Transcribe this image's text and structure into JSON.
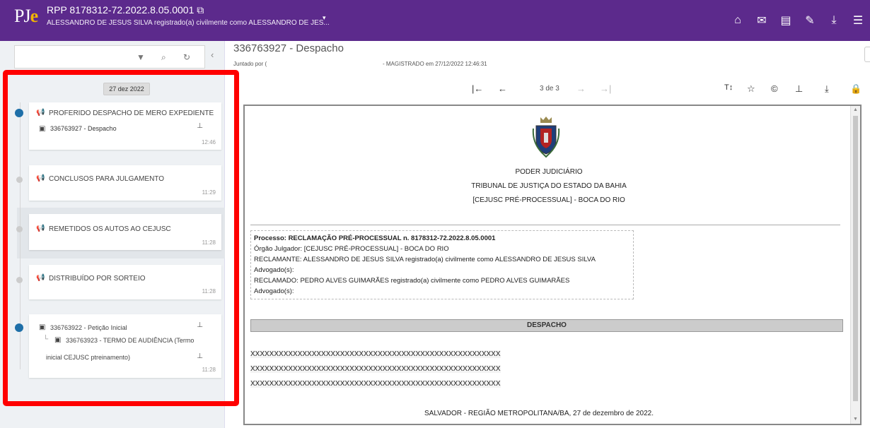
{
  "header": {
    "logo_p": "PJ",
    "logo_e": "e",
    "process_title": "RPP 8178312-72.2022.8.05.0001",
    "subtitle": "ALESSANDRO DE JESUS SILVA registrado(a) civilmente como ALESSANDRO DE JES...",
    "icons": [
      "home-icon",
      "mail-icon",
      "document-icon",
      "edit-icon",
      "download-icon",
      "menu-icon"
    ]
  },
  "timeline": {
    "date": "27 dez 2022",
    "items": [
      {
        "title": "PROFERIDO DESPACHO DE MERO EXPEDIENTE",
        "doc": "336763927 - Despacho",
        "time": "12:46"
      },
      {
        "title": "CONCLUSOS PARA JULGAMENTO",
        "time": "11:29"
      },
      {
        "title": "REMETIDOS OS AUTOS AO CEJUSC",
        "time": "11:28"
      },
      {
        "title": "DISTRIBUÍDO POR SORTEIO",
        "time": "11:28"
      },
      {
        "doc": "336763922 - Petição Inicial",
        "subdoc_a": "336763923 - TERMO DE AUDIÊNCIA (Termo",
        "subdoc_b": "inicial CEJUSC ptreinamento)",
        "time": "11:28"
      }
    ]
  },
  "document": {
    "title": "336763927 - Despacho",
    "juntado": "Juntado por (",
    "magistrado": "- MAGISTRADO em 27/12/2022 12:46:31",
    "page_info": "3 de 3"
  },
  "content": {
    "h1": "PODER JUDICIÁRIO",
    "h2": "TRIBUNAL  DE JUSTIÇA DO ESTADO DA BAHIA",
    "h3": "[CEJUSC PRÉ-PROCESSUAL] - BOCA DO RIO",
    "processo": "Processo: RECLAMAÇÃO PRÉ-PROCESSUAL n. 8178312-72.2022.8.05.0001",
    "orgao": "Órgão Julgador: [CEJUSC PRÉ-PROCESSUAL] - BOCA DO RIO",
    "reclamante": "RECLAMANTE: ALESSANDRO DE JESUS SILVA registrado(a) civilmente como ALESSANDRO DE JESUS SILVA",
    "adv1": "Advogado(s):",
    "reclamado": "RECLAMADO: PEDRO ALVES GUIMARÃES registrado(a) civilmente como PEDRO ALVES GUIMARÃES",
    "adv2": "Advogado(s):",
    "despacho": "DESPACHO",
    "x1": "XXXXXXXXXXXXXXXXXXXXXXXXXXXXXXXXXXXXXXXXXXXXXXXXXXXXX",
    "x2": "XXXXXXXXXXXXXXXXXXXXXXXXXXXXXXXXXXXXXXXXXXXXXXXXXXXXX",
    "x3": "XXXXXXXXXXXXXXXXXXXXXXXXXXXXXXXXXXXXXXXXXXXXXXXXXXXXX",
    "footer": "SALVADOR - REGIÃO METROPOLITANA/BA, 27 de dezembro de 2022."
  },
  "colors": {
    "topbar": "#5c2a8c",
    "logo_e": "#f2b500",
    "highlight_frame": "#ff0000",
    "timeline_dot": "#1e6fa8"
  }
}
